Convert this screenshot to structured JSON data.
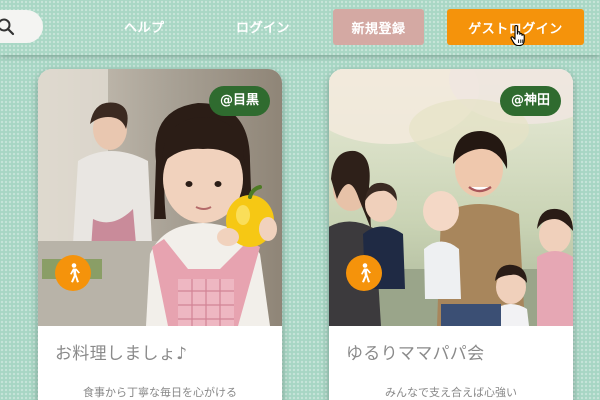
{
  "header": {
    "help_label": "ヘルプ",
    "login_label": "ログイン",
    "register_label": "新規登録",
    "guest_login_label": "ゲストログイン"
  },
  "cards": [
    {
      "location": "@目黒",
      "title": "お料理しましょ♪",
      "description": "食事から丁寧な毎日を心がける"
    },
    {
      "location": "@神田",
      "title": "ゆるりママパパ会",
      "description": "みんなで支え合えば心強い"
    }
  ],
  "colors": {
    "background": "#a7d6c4",
    "guest_button": "#f5930b",
    "register_button": "#d4a9a3",
    "location_badge": "#2f6b2f",
    "walk_badge": "#f5930b"
  },
  "icons": {
    "search": "search-icon",
    "cursor": "hand-pointer-icon",
    "walk": "walking-person-icon"
  }
}
